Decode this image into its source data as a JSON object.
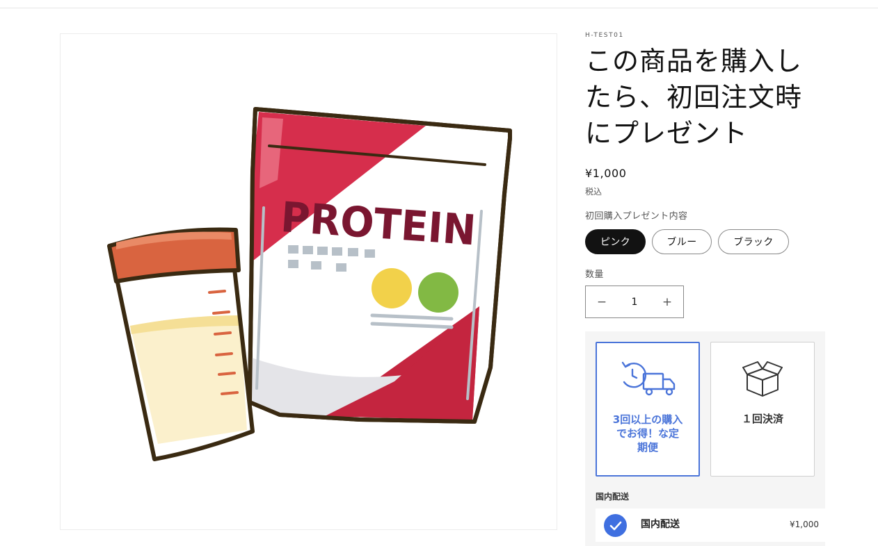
{
  "product": {
    "sku": "H-TEST01",
    "title": "この商品を購入したら、初回注文時にプレゼント",
    "price": "¥1,000",
    "tax_note": "税込",
    "image_text": "PROTEIN"
  },
  "options": {
    "label": "初回購入プレゼント内容",
    "values": [
      "ピンク",
      "ブルー",
      "ブラック"
    ],
    "selected": "ピンク"
  },
  "quantity": {
    "label": "数量",
    "value": "1",
    "minus": "−",
    "plus": "+"
  },
  "purchase_types": {
    "cards": [
      {
        "label": "3回以上の購入でお得！な定期便",
        "icon": "subscription-truck-icon",
        "selected": true
      },
      {
        "label": "１回決済",
        "icon": "box-icon",
        "selected": false
      }
    ],
    "accent_color": "#4a74d9"
  },
  "shipping": {
    "title": "国内配送",
    "options": [
      {
        "name": "国内配送",
        "price": "¥1,000",
        "checked": true
      }
    ]
  }
}
